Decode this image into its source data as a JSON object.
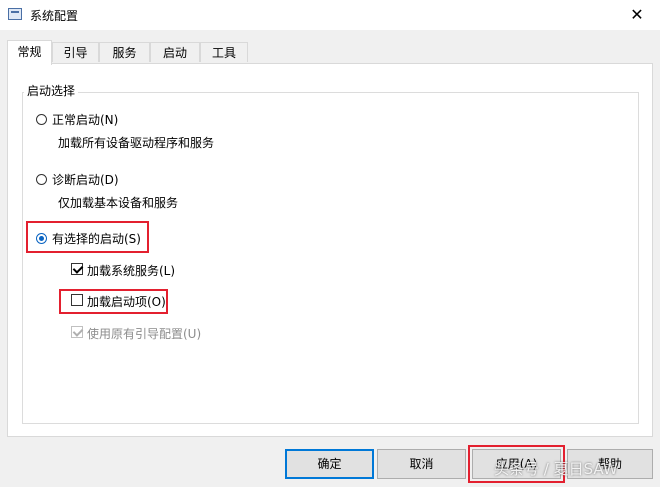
{
  "window": {
    "title": "系统配置",
    "close_glyph": "✕",
    "icon": "system-config-icon"
  },
  "tabs": [
    {
      "label": "常规",
      "active": true
    },
    {
      "label": "引导",
      "active": false
    },
    {
      "label": "服务",
      "active": false
    },
    {
      "label": "启动",
      "active": false
    },
    {
      "label": "工具",
      "active": false
    }
  ],
  "startup_group": {
    "title": "启动选择",
    "normal": {
      "label": "正常启动(N)",
      "description": "加载所有设备驱动程序和服务",
      "selected": false
    },
    "diagnostic": {
      "label": "诊断启动(D)",
      "description": "仅加载基本设备和服务",
      "selected": false
    },
    "selective": {
      "label": "有选择的启动(S)",
      "selected": true
    },
    "options": {
      "load_services": {
        "label": "加载系统服务(L)",
        "checked": true,
        "enabled": true
      },
      "load_startup_items": {
        "label": "加载启动项(O)",
        "checked": false,
        "enabled": true
      },
      "use_original_boot": {
        "label": "使用原有引导配置(U)",
        "checked": true,
        "enabled": false
      }
    }
  },
  "buttons": {
    "ok": "确定",
    "cancel": "取消",
    "apply": "应用(A)",
    "help": "帮助"
  },
  "highlight_color": "#e3202f",
  "watermark": "头条号 / 夏日SAW"
}
